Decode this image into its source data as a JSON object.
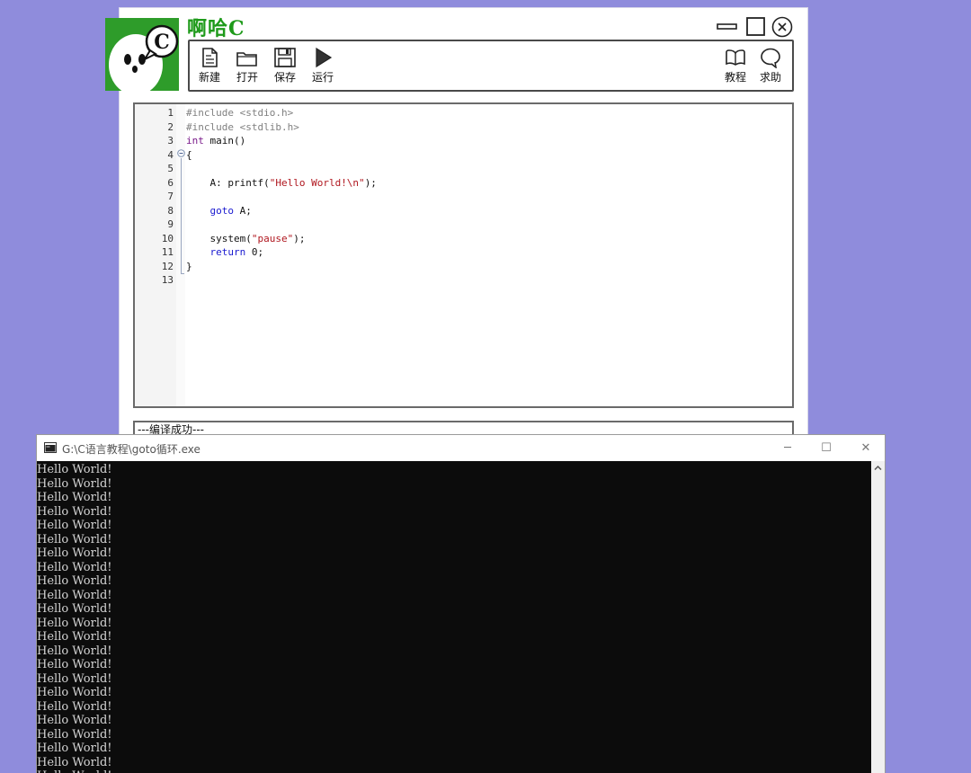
{
  "app": {
    "title": "啊哈C",
    "logo_letter": "C"
  },
  "toolbar": {
    "new_label": "新建",
    "open_label": "打开",
    "save_label": "保存",
    "run_label": "运行",
    "tutorial_label": "教程",
    "help_label": "求助"
  },
  "editor": {
    "line_numbers": [
      "1",
      "2",
      "3",
      "4",
      "5",
      "6",
      "7",
      "8",
      "9",
      "10",
      "11",
      "12",
      "13"
    ],
    "lines": [
      [
        {
          "t": "#include <stdio.h>",
          "c": "pp"
        }
      ],
      [
        {
          "t": "#include <stdlib.h>",
          "c": "pp"
        }
      ],
      [
        {
          "t": "int",
          "c": "kwr"
        },
        {
          "t": " main()",
          "c": ""
        }
      ],
      [
        {
          "t": "{",
          "c": ""
        }
      ],
      [],
      [
        {
          "t": "    A: printf(",
          "c": ""
        },
        {
          "t": "\"Hello World!\\n\"",
          "c": "str"
        },
        {
          "t": ");",
          "c": ""
        }
      ],
      [],
      [
        {
          "t": "    ",
          "c": ""
        },
        {
          "t": "goto",
          "c": "kw"
        },
        {
          "t": " A;",
          "c": ""
        }
      ],
      [],
      [
        {
          "t": "    system(",
          "c": ""
        },
        {
          "t": "\"pause\"",
          "c": "str"
        },
        {
          "t": ");",
          "c": ""
        }
      ],
      [
        {
          "t": "    ",
          "c": ""
        },
        {
          "t": "return",
          "c": "kw"
        },
        {
          "t": " 0;",
          "c": ""
        }
      ],
      [
        {
          "t": "}",
          "c": ""
        }
      ],
      []
    ]
  },
  "status": {
    "message": "---编译成功---"
  },
  "console": {
    "title": "G:\\C语言教程\\goto循环.exe",
    "minimize": "─",
    "maximize": "☐",
    "close": "✕",
    "output_line": "Hello World!",
    "output_count": 23
  },
  "colors": {
    "background": "#8f8cdc",
    "logo_green": "#2e9c2a",
    "title_green": "#1e9a1a",
    "console_bg": "#0c0c0c"
  }
}
